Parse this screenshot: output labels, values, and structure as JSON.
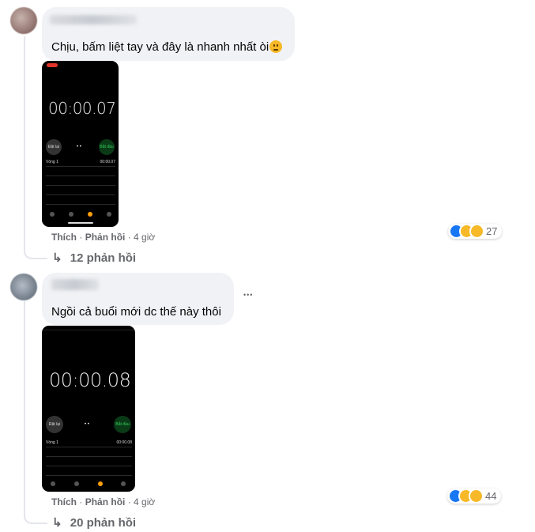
{
  "comments": [
    {
      "text": "Chịu, bấm liệt tay và đây là nhanh nhất òi",
      "emoji": "slightly-frowning-face",
      "stopwatch": {
        "time": "00:00.07",
        "left_button": "Đặt lại",
        "right_button": "Bắt đầu",
        "lap_label": "Vòng 1",
        "lap_time": "00:00.07"
      },
      "actions": {
        "like": "Thích",
        "reply": "Phản hồi",
        "age": "4 giờ"
      },
      "reaction_count": "27",
      "replies_label": "12 phản hồi"
    },
    {
      "text": "Ngồi cả buổi mới dc thế này thôi",
      "stopwatch": {
        "time": "00:00.08",
        "left_button": "Đặt lại",
        "right_button": "Bắt đầu",
        "lap_label": "Vòng 1",
        "lap_time": "00:00.08"
      },
      "actions": {
        "like": "Thích",
        "reply": "Phản hồi",
        "age": "4 giờ"
      },
      "reaction_count": "44",
      "replies_label": "20 phản hồi",
      "more_icon": "more-horizontal-icon"
    }
  ],
  "reactions": [
    "like-icon",
    "haha-icon",
    "wow-icon"
  ],
  "sep": "·",
  "reply_arrow": "↳",
  "more": "•••"
}
